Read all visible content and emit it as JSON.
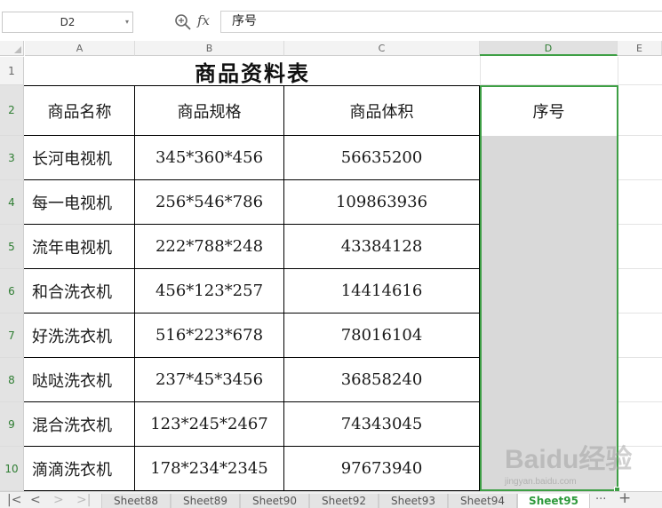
{
  "formula_bar": {
    "cell_ref": "D2",
    "fx_label": "fx",
    "formula": "序号",
    "zoom_icon": "zoom-icon",
    "name_box_arrow": "▾"
  },
  "columns": [
    "A",
    "B",
    "C",
    "D",
    "E"
  ],
  "selected_column": "D",
  "rows": [
    "1",
    "2",
    "3",
    "4",
    "5",
    "6",
    "7",
    "8",
    "9",
    "10"
  ],
  "sheet": {
    "title": "商品资料表",
    "headers": [
      "商品名称",
      "商品规格",
      "商品体积",
      "序号"
    ],
    "data": [
      [
        "长河电视机",
        "345*360*456",
        "56635200"
      ],
      [
        "每一电视机",
        "256*546*786",
        "109863936"
      ],
      [
        "流年电视机",
        "222*788*248",
        "43384128"
      ],
      [
        "和合洗衣机",
        "456*123*257",
        "14414616"
      ],
      [
        "好洗洗衣机",
        "516*223*678",
        "78016104"
      ],
      [
        "哒哒洗衣机",
        "237*45*3456",
        "36858240"
      ],
      [
        "混合洗衣机",
        "123*245*2467",
        "74343045"
      ],
      [
        "滴滴洗衣机",
        "178*234*2345",
        "97673940"
      ]
    ]
  },
  "tabs": {
    "nav": [
      "|<",
      "<",
      ">",
      ">|"
    ],
    "sheets": [
      "Sheet88",
      "Sheet89",
      "Sheet90",
      "Sheet92",
      "Sheet93",
      "Sheet94",
      "Sheet95"
    ],
    "active": "Sheet95",
    "more": "···",
    "add": "+"
  },
  "watermark": {
    "brand": "Baidu经验",
    "url": "jingyan.baidu.com"
  },
  "colors": {
    "selection": "#3e9f45",
    "active_tab": "#2e9a3c",
    "fill": "#d9d9d9"
  }
}
